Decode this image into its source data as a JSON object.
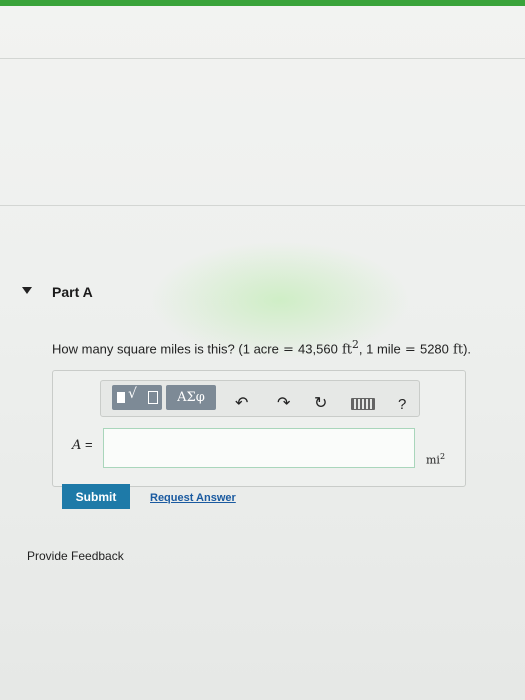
{
  "part": {
    "title": "Part A"
  },
  "question": {
    "prefix": "How many square miles is this? (",
    "acre": "1 acre",
    "eq1": " = ",
    "acre_value": "43,560",
    "ft": " ft",
    "sq": "2",
    "sep": ", ",
    "mile": "1 mile",
    "eq2": " = ",
    "mile_value": "5280",
    "ft2": " ft",
    "suffix": ")."
  },
  "toolbar": {
    "templates_icon": "templates-icon",
    "greek_label": "ΑΣφ",
    "undo": "↶",
    "redo": "↷",
    "reset": "↻",
    "keyboard_icon": "keyboard-icon",
    "help": "?"
  },
  "answer": {
    "label_var": "A",
    "label_eq": " =",
    "value": "",
    "unit": "mi",
    "unit_exp": "2"
  },
  "actions": {
    "submit": "Submit",
    "request_answer": "Request Answer",
    "provide_feedback": "Provide Feedback"
  },
  "colors": {
    "top_bar": "#3aa33a",
    "submit_bg": "#1e7aa8",
    "link": "#1a5aa0",
    "toolbar_btn": "#7d8a96"
  }
}
